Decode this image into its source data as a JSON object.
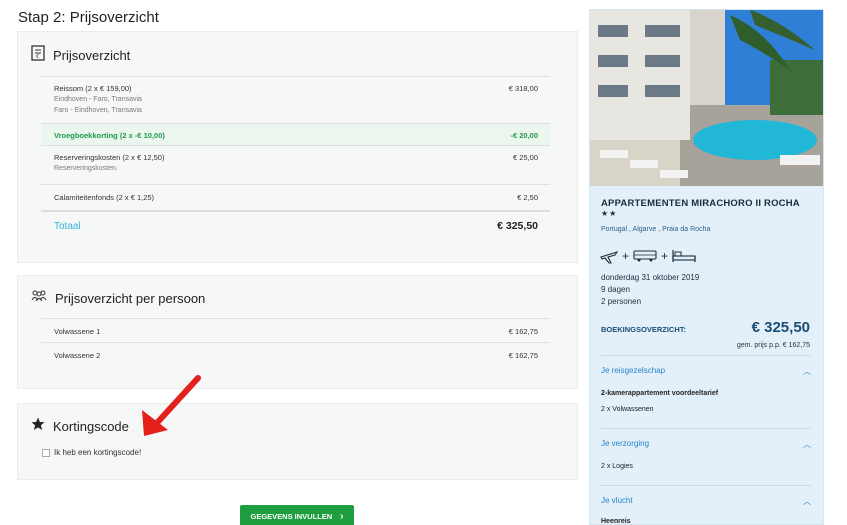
{
  "page": {
    "title": "Stap 2: Prijsoverzicht"
  },
  "price_card": {
    "title": "Prijsoverzicht",
    "rows": [
      {
        "label": "Reissom (2 x € 159,00)",
        "sub1": "Eindhoven - Faro, Transavia",
        "sub2": "Faro - Eindhoven, Transavia",
        "amount": "€ 318,00"
      },
      {
        "label": "Vroegboekkorting (2 x -€ 10,00)",
        "amount": "-€ 20,00"
      },
      {
        "label": "Reserveringskosten (2 x € 12,50)",
        "sub1": "Reserveringskosten.",
        "amount": "€ 25,00"
      },
      {
        "label": "Calamiteitenfonds (2 x € 1,25)",
        "amount": "€ 2,50"
      },
      {
        "label": "Totaal",
        "amount": "€ 325,50"
      }
    ]
  },
  "person_card": {
    "title": "Prijsoverzicht per persoon",
    "rows": [
      {
        "label": "Volwassene 1",
        "amount": "€ 162,75"
      },
      {
        "label": "Volwassene 2",
        "amount": "€ 162,75"
      }
    ]
  },
  "discount_card": {
    "title": "Kortingscode",
    "checkbox_label": "Ik heb een kortingscode!"
  },
  "cta": {
    "label": "GEGEVENS INVULLEN"
  },
  "sidebar": {
    "hotel_name": "APPARTEMENTEN MIRACHORO II ROCHA",
    "stars": "★★",
    "location": "Portugal , Algarve , Praia da Rocha",
    "date": "donderdag 31 oktober 2019",
    "duration": "9 dagen",
    "persons": "2 personen",
    "booking_label": "BOEKINGSOVERZICHT:",
    "booking_price": "€ 325,50",
    "price_pp": "gem. prijs p.p. € 162,75",
    "sections": [
      {
        "title": "Je reisgezelschap",
        "items": [
          "2-kamerappartement voordeeltarief",
          "2 x Volwassenen"
        ]
      },
      {
        "title": "Je verzorging",
        "items": [
          "2 x Logies"
        ]
      },
      {
        "title": "Je vlucht",
        "items": [
          "Heenreis"
        ]
      }
    ]
  },
  "colors": {
    "accent_green": "#1e9e3f",
    "discount_green": "#1f9a4b",
    "total_blue": "#38b1d6",
    "sidebar_blue": "#1a4d74",
    "link_blue": "#2683c6",
    "arrow_red": "#e3201b"
  }
}
